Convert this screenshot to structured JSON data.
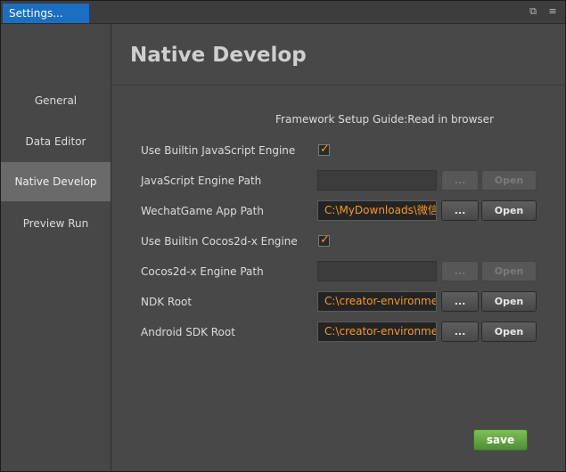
{
  "window": {
    "tab_title": "Settings..."
  },
  "sidebar": {
    "items": [
      {
        "label": "General"
      },
      {
        "label": "Data Editor"
      },
      {
        "label": "Native Develop"
      },
      {
        "label": "Preview Run"
      }
    ]
  },
  "main": {
    "title": "Native Develop",
    "guide_text": "Framework Setup Guide:Read in browser",
    "rows": [
      {
        "label": "Use Builtin JavaScript Engine",
        "checked": true
      },
      {
        "label": "JavaScript Engine Path",
        "value": "",
        "enabled": false,
        "dots_label": "...",
        "open_label": "Open"
      },
      {
        "label": "WechatGame App Path",
        "value": "C:\\MyDownloads\\微信",
        "enabled": true,
        "dots_label": "...",
        "open_label": "Open"
      },
      {
        "label": "Use Builtin Cocos2d-x Engine",
        "checked": true
      },
      {
        "label": "Cocos2d-x Engine Path",
        "value": "",
        "enabled": false,
        "dots_label": "...",
        "open_label": "Open"
      },
      {
        "label": "NDK Root",
        "value": "C:\\creator-environmer",
        "enabled": true,
        "dots_label": "...",
        "open_label": "Open"
      },
      {
        "label": "Android SDK Root",
        "value": "C:\\creator-environmer",
        "enabled": true,
        "dots_label": "...",
        "open_label": "Open"
      }
    ],
    "save_label": "save"
  },
  "colors": {
    "tab_accent": "#1a6fc2",
    "path_text": "#f39a2a",
    "checkmark": "#f1a020",
    "save_button": "#5fa03f"
  }
}
